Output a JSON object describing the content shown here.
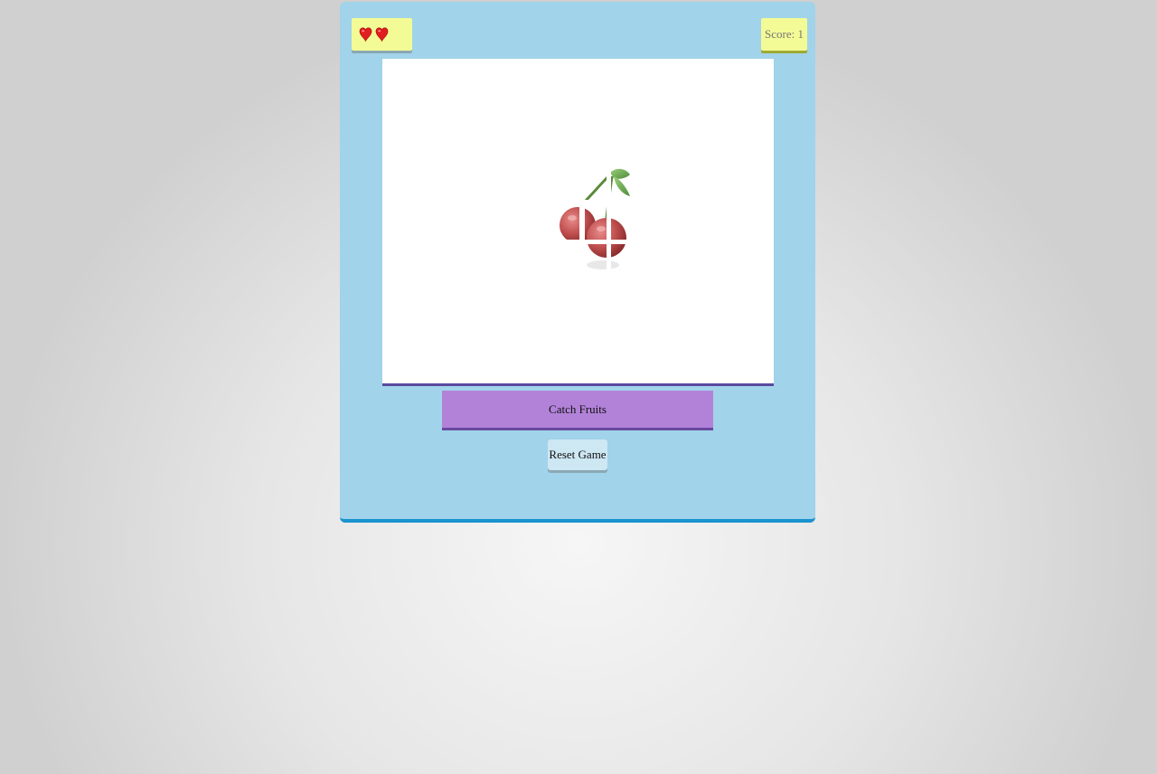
{
  "game": {
    "lives": {
      "count": 2,
      "icon": "heart-icon",
      "color": "#e02020"
    },
    "score_text": "Score: 1",
    "score": 1,
    "fruit": {
      "kind": "cherry-icon"
    },
    "action_button_label": "Catch Fruits",
    "reset_button_label": "Reset Game"
  },
  "colors": {
    "panel": "#a1d3ea",
    "panel_border": "#1a93cf",
    "info_box": "#f2fb95",
    "action_button": "#b282d9",
    "reset_button": "#cde7f3",
    "play_area": "#ffffff"
  }
}
